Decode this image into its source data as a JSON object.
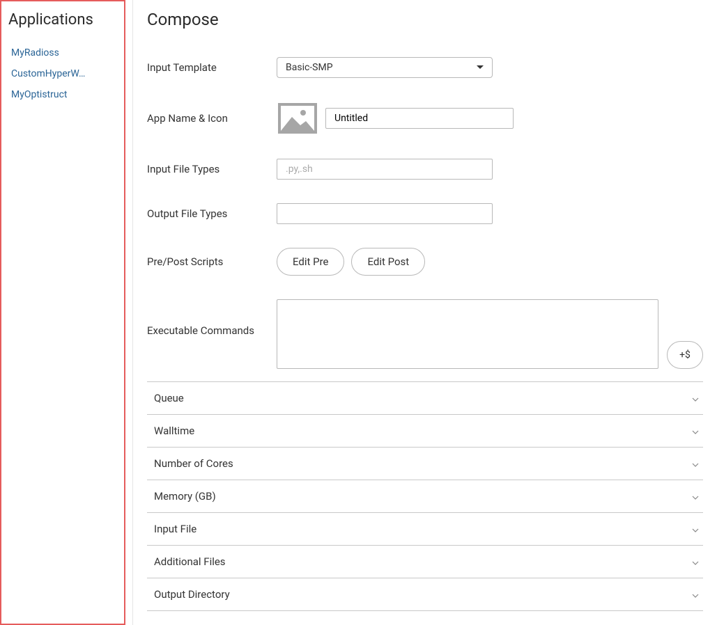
{
  "sidebar": {
    "title": "Applications",
    "items": [
      {
        "label": "MyRadioss"
      },
      {
        "label": "CustomHyperW…"
      },
      {
        "label": "MyOptistruct"
      }
    ]
  },
  "page": {
    "title": "Compose"
  },
  "form": {
    "input_template_label": "Input Template",
    "input_template_value": "Basic-SMP",
    "app_name_icon_label": "App Name & Icon",
    "app_name_value": "Untitled",
    "input_file_types_label": "Input File Types",
    "input_file_types_placeholder": ".py,.sh",
    "input_file_types_value": "",
    "output_file_types_label": "Output File Types",
    "output_file_types_value": "",
    "prepost_label": "Pre/Post Scripts",
    "edit_pre_label": "Edit Pre",
    "edit_post_label": "Edit Post",
    "exec_commands_label": "Executable Commands",
    "exec_commands_value": "",
    "add_var_label": "+$"
  },
  "accordion": [
    {
      "label": "Queue"
    },
    {
      "label": "Walltime"
    },
    {
      "label": "Number of Cores"
    },
    {
      "label": "Memory (GB)"
    },
    {
      "label": "Input File"
    },
    {
      "label": "Additional Files"
    },
    {
      "label": "Output Directory"
    }
  ]
}
